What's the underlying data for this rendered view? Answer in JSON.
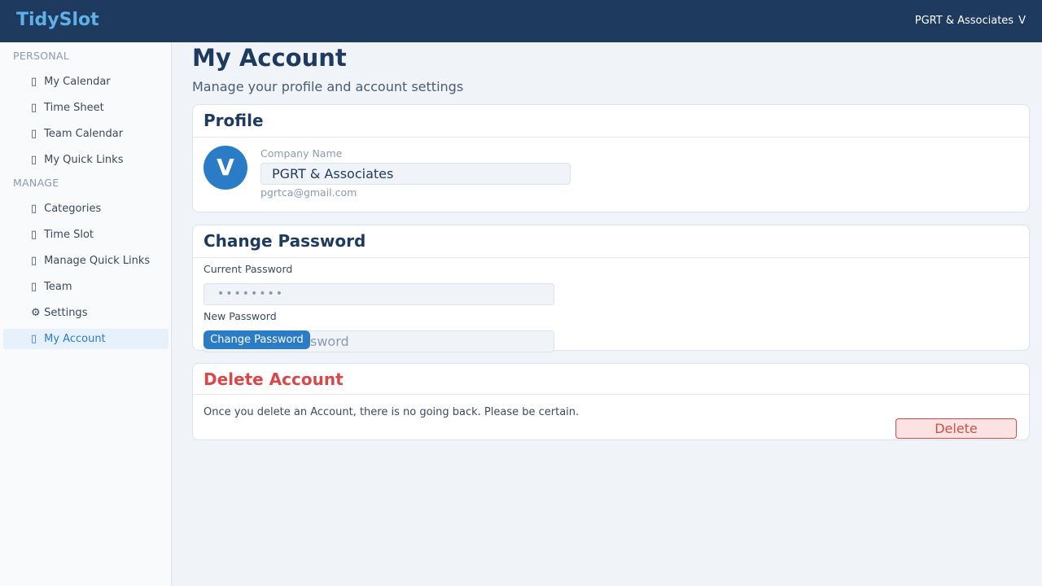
{
  "app": {
    "brand": "TidySlot",
    "account_name": "PGRT & Associates",
    "account_initial": "V"
  },
  "sidebar": {
    "sections": [
      {
        "label": "PERSONAL"
      },
      {
        "label": "MANAGE"
      }
    ],
    "items": [
      {
        "icon": "calendar-icon",
        "glyph": "▯",
        "label": "My Calendar"
      },
      {
        "icon": "clock-icon",
        "glyph": "▯",
        "label": "Time Sheet"
      },
      {
        "icon": "team-calendar-icon",
        "glyph": "▯",
        "label": "Team Calendar"
      },
      {
        "icon": "link-icon",
        "glyph": "▯",
        "label": "My Quick Links"
      },
      {
        "icon": "tag-icon",
        "glyph": "▯",
        "label": "Categories"
      },
      {
        "icon": "hourglass-icon",
        "glyph": "▯",
        "label": "Time Slot"
      },
      {
        "icon": "link-icon",
        "glyph": "▯",
        "label": "Manage Quick Links"
      },
      {
        "icon": "users-icon",
        "glyph": "▯",
        "label": "Team"
      },
      {
        "icon": "gear-icon",
        "glyph": "⚙",
        "label": "Settings"
      },
      {
        "icon": "user-icon",
        "glyph": "▯",
        "label": "My Account"
      }
    ]
  },
  "main": {
    "title": "My Account",
    "subtitle": "Manage your profile and account settings"
  },
  "profile": {
    "title": "Profile",
    "avatar_initial": "V",
    "company_label": "Company Name",
    "company_value": "PGRT & Associates",
    "email": "pgrtca@gmail.com"
  },
  "password": {
    "title": "Change Password",
    "current_label": "Current Password",
    "current_value": "••••••••",
    "new_label": "New Password",
    "new_placeholder_visible": "sword",
    "button_label": "Change Password"
  },
  "delete": {
    "title": "Delete Account",
    "warning": "Once you delete an Account, there is no going back. Please be certain.",
    "button_label": "Delete"
  },
  "colors": {
    "topbar": "#1e3a5f",
    "brand": "#5fb0e8",
    "accent": "#2b7cc6",
    "danger": "#d94848"
  }
}
